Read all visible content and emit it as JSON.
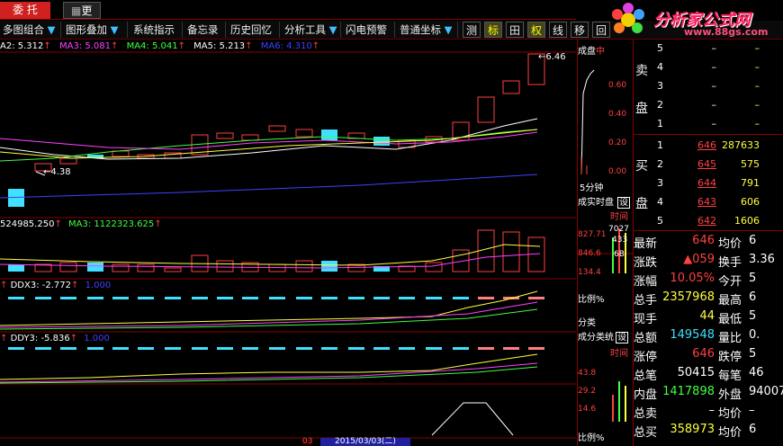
{
  "tabs": [
    {
      "label": "委 托"
    },
    {
      "label": "更多"
    }
  ],
  "toolbar": {
    "items": [
      "多图组合",
      "图形叠加",
      "系统指示",
      "备忘录",
      "历史回忆",
      "分析工具",
      "闪电预警",
      "普通坐标"
    ],
    "squares": [
      "测",
      "标",
      "田",
      "权",
      "线",
      "移",
      "回"
    ]
  },
  "logo": {
    "text": "分析家公式网",
    "url": "www.88gs.com"
  },
  "main": {
    "ma_line": [
      "A2: 5.312",
      "MA3: 5.081",
      "MA4: 5.041",
      "MA5: 5.213",
      "MA6: 4.310"
    ],
    "price_high": "6.46",
    "price_low": "4.38",
    "vol_line": [
      "524985.250",
      "MA3: 1122323.625"
    ],
    "ddx_line": [
      "DDX3: -2.772",
      "1.000"
    ],
    "ddy_line": [
      "DDY3: -5.836",
      "1.000"
    ],
    "date": "2015/03/03(二)",
    "date_left": "03"
  },
  "mini": {
    "title": "成盘",
    "title2": "中",
    "ticks": [
      "0.60",
      "0.40",
      "0.20",
      "0.00"
    ],
    "period": "5分钟",
    "realtime": "成实时盘",
    "set": "设",
    "time_label": "时间",
    "vol_ticks": [
      "7027",
      "433",
      "6B",
      "134.4"
    ],
    "vol_top": "827.71",
    "vol_mid": "846.6",
    "ratio": "比例%",
    "cat": "分类",
    "cat2": "成分类统",
    "pct_ticks": [
      "43.8",
      "29.2",
      "14.6"
    ],
    "ratio2": "比例%"
  },
  "orderbook": {
    "sell_label": "卖",
    "sell_label2": "盘",
    "buy_label": "买",
    "buy_label2": "盘",
    "sell": [
      {
        "lvl": "5",
        "price": "–",
        "vol": "–"
      },
      {
        "lvl": "4",
        "price": "–",
        "vol": "–"
      },
      {
        "lvl": "3",
        "price": "–",
        "vol": "–"
      },
      {
        "lvl": "2",
        "price": "–",
        "vol": "–"
      },
      {
        "lvl": "1",
        "price": "–",
        "vol": "–"
      }
    ],
    "buy": [
      {
        "lvl": "1",
        "price": "646",
        "vol": "287633"
      },
      {
        "lvl": "2",
        "price": "645",
        "vol": "575"
      },
      {
        "lvl": "3",
        "price": "644",
        "vol": "791"
      },
      {
        "lvl": "4",
        "price": "643",
        "vol": "606"
      },
      {
        "lvl": "5",
        "price": "642",
        "vol": "1606"
      }
    ]
  },
  "stats": [
    {
      "k1": "最新",
      "v1": "646",
      "k2": "均价",
      "v2": "6",
      "c1": "#ff4040"
    },
    {
      "k1": "涨跌",
      "v1": "▲059",
      "k2": "换手",
      "v2": "3.36",
      "c1": "#ff4040"
    },
    {
      "k1": "涨幅",
      "v1": "10.05%",
      "k2": "今开",
      "v2": "5",
      "c1": "#ff4040"
    },
    {
      "k1": "总手",
      "v1": "2357968",
      "k2": "最高",
      "v2": "6",
      "c1": "#ffff40"
    },
    {
      "k1": "现手",
      "v1": "44",
      "k2": "最低",
      "v2": "5",
      "c1": "#ffff40"
    },
    {
      "k1": "总额",
      "v1": "149548",
      "k2": "量比",
      "v2": "0.",
      "c1": "#40e0ff"
    },
    {
      "k1": "涨停",
      "v1": "646",
      "k2": "跌停",
      "v2": "5",
      "c1": "#ff4040"
    },
    {
      "k1": "总笔",
      "v1": "50415",
      "k2": "每笔",
      "v2": "46",
      "c1": "#ffffff"
    },
    {
      "k1": "内盘",
      "v1": "1417898",
      "k2": "外盘",
      "v2": "94007",
      "c1": "#40ff40"
    },
    {
      "k1": "总卖",
      "v1": "–",
      "k2": "均价",
      "v2": "–",
      "c1": "#ffffff"
    },
    {
      "k1": "总买",
      "v1": "358973",
      "k2": "均价",
      "v2": "6",
      "c1": "#ffff40"
    }
  ],
  "colors": {
    "up": "#ff4040",
    "down": "#40e0ff",
    "grid": "#800000"
  }
}
